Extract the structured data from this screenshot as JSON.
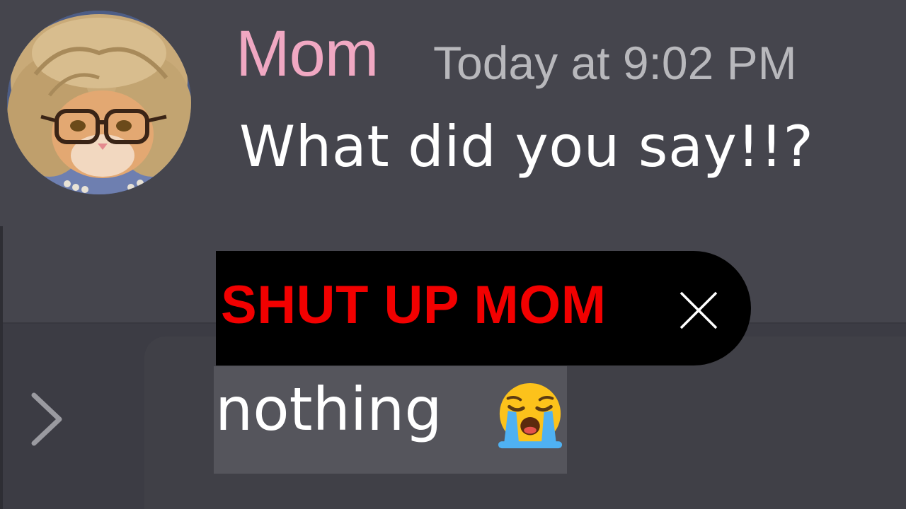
{
  "message": {
    "author": "Mom",
    "timestamp": "Today at 9:02 PM",
    "text": "What did you say!!?",
    "author_color": "#f0a8c2"
  },
  "draft": {
    "text": "SHUT UP MOM",
    "color": "#f20000",
    "status_icon": "x-icon"
  },
  "composer": {
    "value": "nothing",
    "emoji": "loudly-crying-face-icon",
    "expand_icon": "chevron-right-icon"
  }
}
